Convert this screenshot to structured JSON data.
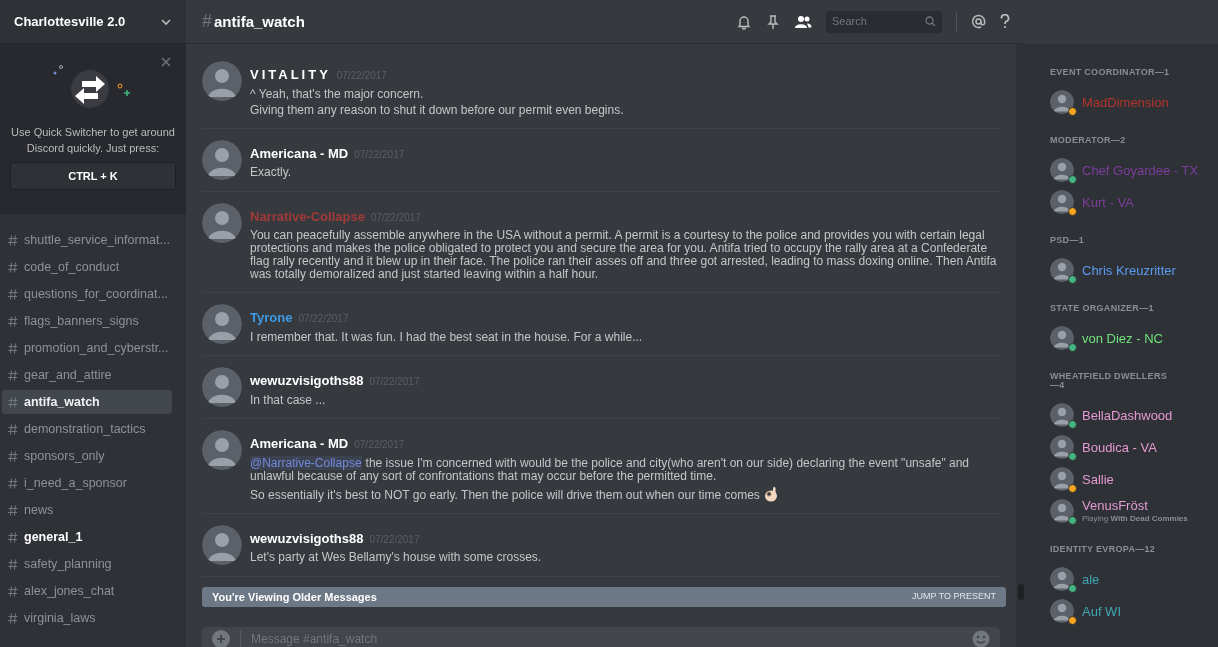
{
  "server": {
    "name": "Charlottesville 2.0"
  },
  "quick_switcher": {
    "text": "Use Quick Switcher to get around Discord quickly. Just press:",
    "shortcut": "CTRL + K"
  },
  "channels": [
    {
      "name": "shuttle_service_informat...",
      "selected": false,
      "unread": false
    },
    {
      "name": "code_of_conduct",
      "selected": false,
      "unread": false
    },
    {
      "name": "questions_for_coordinat...",
      "selected": false,
      "unread": false
    },
    {
      "name": "flags_banners_signs",
      "selected": false,
      "unread": false
    },
    {
      "name": "promotion_and_cyberstr...",
      "selected": false,
      "unread": false
    },
    {
      "name": "gear_and_attire",
      "selected": false,
      "unread": false
    },
    {
      "name": "antifa_watch",
      "selected": true,
      "unread": false
    },
    {
      "name": "demonstration_tactics",
      "selected": false,
      "unread": false
    },
    {
      "name": "sponsors_only",
      "selected": false,
      "unread": false
    },
    {
      "name": "i_need_a_sponsor",
      "selected": false,
      "unread": false
    },
    {
      "name": "news",
      "selected": false,
      "unread": false
    },
    {
      "name": "general_1",
      "selected": false,
      "unread": true
    },
    {
      "name": "safety_planning",
      "selected": false,
      "unread": false
    },
    {
      "name": "alex_jones_chat",
      "selected": false,
      "unread": false
    },
    {
      "name": "virginia_laws",
      "selected": false,
      "unread": false
    }
  ],
  "channel_header": {
    "hash": "#",
    "name": "antifa_watch",
    "search_placeholder": "Search"
  },
  "messages": [
    {
      "author": "VITALITY",
      "color": "#ffffff",
      "spaced": true,
      "time": "07/22/2017",
      "lines": [
        {
          "text": "^ Yeah, that's the major concern."
        },
        {
          "text": "Giving them any reason to shut it down before our permit even begins."
        }
      ]
    },
    {
      "author": "Americana - MD",
      "color": "#ffffff",
      "spaced": false,
      "time": "07/22/2017",
      "lines": [
        {
          "text": "Exactly."
        }
      ]
    },
    {
      "author": "Narrative-Collapse",
      "color": "#a33a3a",
      "spaced": false,
      "time": "07/22/2017",
      "lines": [
        {
          "text": "You can peacefully assemble anywhere in the USA without a permit. A permit is a courtesy to the police and provides you with certain legal protections and makes the police obligated to protect you and secure the area for you. Antifa tried to occupy the rally area at a Confederate flag rally recently and it blew up in their face. The police ran their asses off and three got arrested, leading to mass doxing online. Then Antifa was totally demoralized and just started leaving within a half hour."
        }
      ]
    },
    {
      "author": "Tyrone",
      "color": "#3e9be6",
      "spaced": false,
      "time": "07/22/2017",
      "lines": [
        {
          "text": "I remember that. It was fun. I had the best seat in the house. For a while..."
        }
      ]
    },
    {
      "author": "wewuzvisigoths88",
      "color": "#ffffff",
      "spaced": false,
      "time": "07/22/2017",
      "lines": [
        {
          "text": "In that case ..."
        }
      ]
    },
    {
      "author": "Americana - MD",
      "color": "#ffffff",
      "spaced": false,
      "time": "07/22/2017",
      "lines": [
        {
          "mention": "@Narrative-Collapse",
          "text": "the issue I'm concerned with would be the police and city(who aren't on our side) declaring the event \"unsafe\" and unlawful because of any sort of confrontations that may occur before the permitted time."
        },
        {
          "text": "So essentially it's best to NOT go early. Then the police will drive them out when our time comes",
          "emoji": true
        }
      ]
    },
    {
      "author": "wewuzvisigoths88",
      "color": "#ffffff",
      "spaced": false,
      "time": "07/22/2017",
      "lines": [
        {
          "text": "Let's party at Wes Bellamy's house with some crosses."
        }
      ]
    }
  ],
  "older_bar": {
    "text": "You're Viewing Older Messages",
    "action": "JUMP TO PRESENT"
  },
  "composer": {
    "placeholder": "Message #antifa_watch"
  },
  "member_groups": [
    {
      "title": "EVENT COORDINATOR—1",
      "members": [
        {
          "name": "MadDimension",
          "color": "#b3342c",
          "idle": true
        }
      ]
    },
    {
      "title": "MODERATOR—2",
      "members": [
        {
          "name": "Chef Goyardee - TX",
          "color": "#7d3d9c",
          "idle": false
        },
        {
          "name": "Kurt - VA",
          "color": "#7d3d9c",
          "idle": true
        }
      ]
    },
    {
      "title": "PSD—1",
      "members": [
        {
          "name": "Chris Kreuzritter",
          "color": "#5b9cf2",
          "idle": false
        }
      ]
    },
    {
      "title": "STATE ORGANIZER—1",
      "members": [
        {
          "name": "von Diez - NC",
          "color": "#6fe27a",
          "idle": false
        }
      ]
    },
    {
      "title": "WHEATFIELD DWELLERS—4",
      "members": [
        {
          "name": "BellaDashwood",
          "color": "#e59ad4",
          "idle": false
        },
        {
          "name": "Boudica - VA",
          "color": "#e59ad4",
          "idle": false
        },
        {
          "name": "Sallie",
          "color": "#e59ad4",
          "idle": true
        },
        {
          "name": "VenusFröst",
          "color": "#e59ad4",
          "idle": false,
          "activity_prefix": "Playing",
          "activity": "With Dead Commies"
        }
      ]
    },
    {
      "title": "IDENTITY EVROPA—12",
      "members": [
        {
          "name": "ale",
          "color": "#3fa7b3",
          "idle": false
        },
        {
          "name": "Auf WI",
          "color": "#3fa7b3",
          "idle": true
        }
      ]
    }
  ]
}
